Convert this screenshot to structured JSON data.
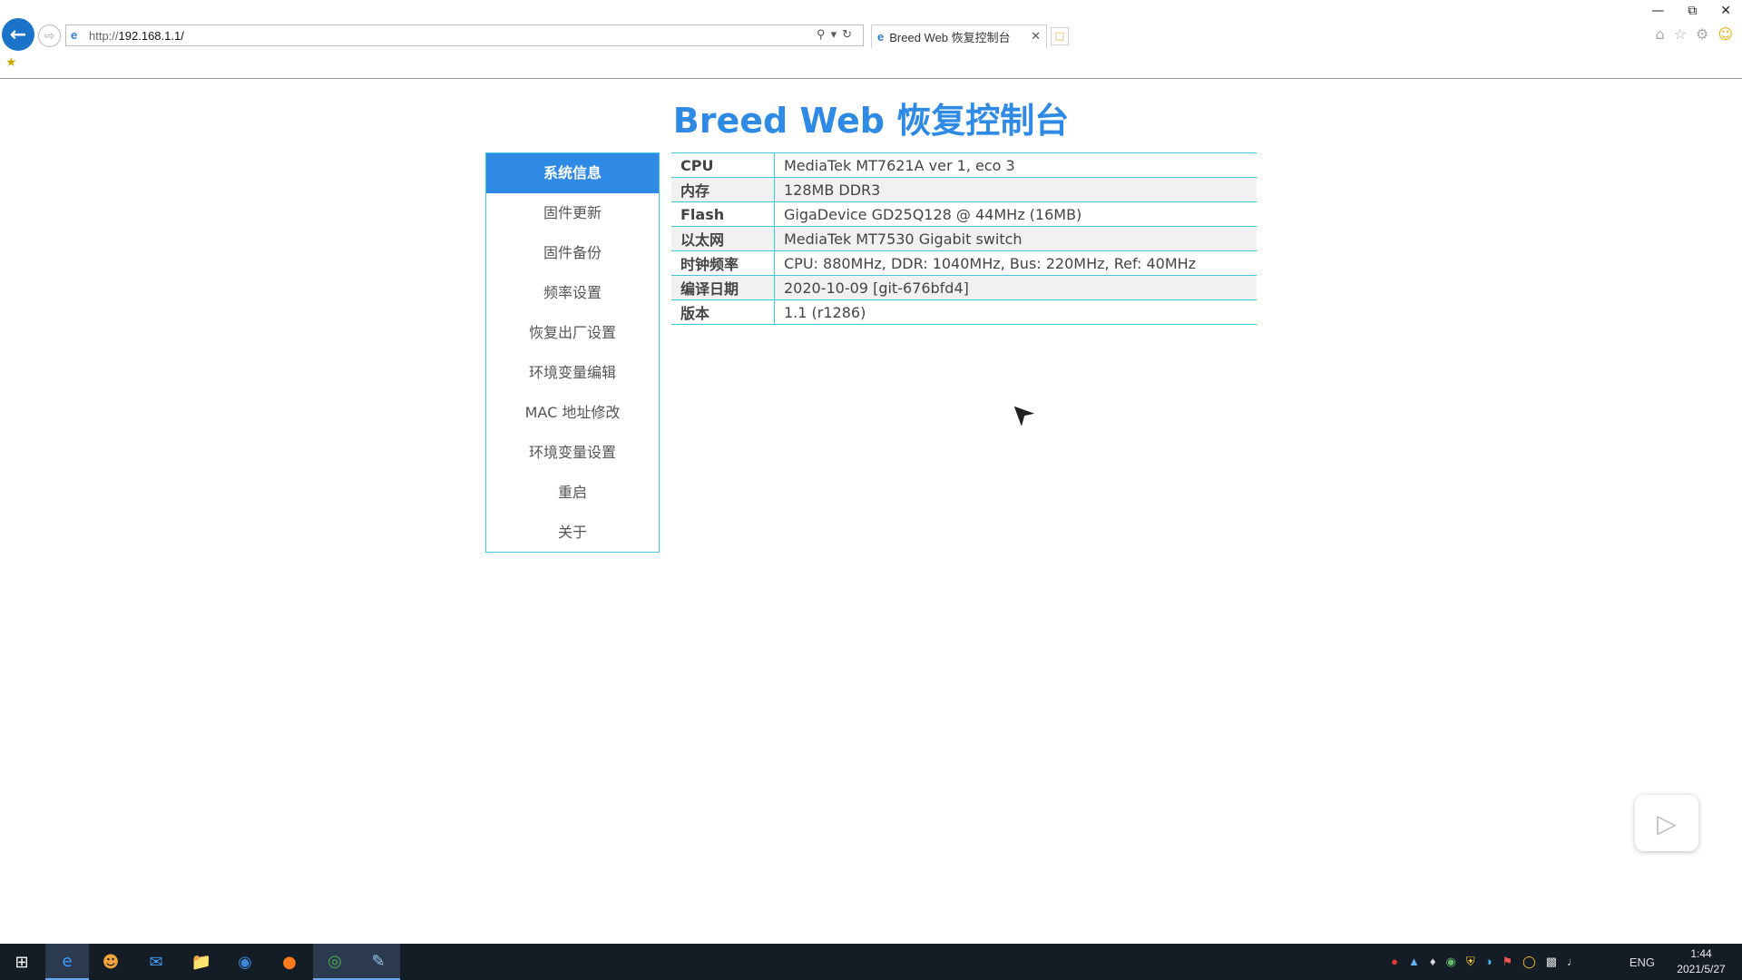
{
  "browser": {
    "url_prefix": "http://",
    "url_host": "192.168.1.1/",
    "tab_title": "Breed Web 恢复控制台"
  },
  "page": {
    "title": "Breed Web 恢复控制台"
  },
  "sidebar": {
    "items": [
      {
        "label": "系统信息"
      },
      {
        "label": "固件更新"
      },
      {
        "label": "固件备份"
      },
      {
        "label": "频率设置"
      },
      {
        "label": "恢复出厂设置"
      },
      {
        "label": "环境变量编辑"
      },
      {
        "label": "MAC 地址修改"
      },
      {
        "label": "环境变量设置"
      },
      {
        "label": "重启"
      },
      {
        "label": "关于"
      }
    ]
  },
  "info_table": {
    "rows": [
      {
        "key": "CPU",
        "value": "MediaTek MT7621A ver 1, eco 3"
      },
      {
        "key": "内存",
        "value": "128MB DDR3"
      },
      {
        "key": "Flash",
        "value": "GigaDevice GD25Q128 @ 44MHz (16MB)"
      },
      {
        "key": "以太网",
        "value": "MediaTek MT7530 Gigabit switch"
      },
      {
        "key": "时钟频率",
        "value": "CPU: 880MHz, DDR: 1040MHz, Bus: 220MHz, Ref: 40MHz"
      },
      {
        "key": "编译日期",
        "value": "2020-10-09 [git-676bfd4]"
      },
      {
        "key": "版本",
        "value": "1.1 (r1286)"
      }
    ]
  },
  "taskbar": {
    "language": "ENG",
    "time": "1:44",
    "date": "2021/5/27"
  },
  "colors": {
    "accent": "#2f8ae6",
    "border": "#3cc9d9"
  }
}
